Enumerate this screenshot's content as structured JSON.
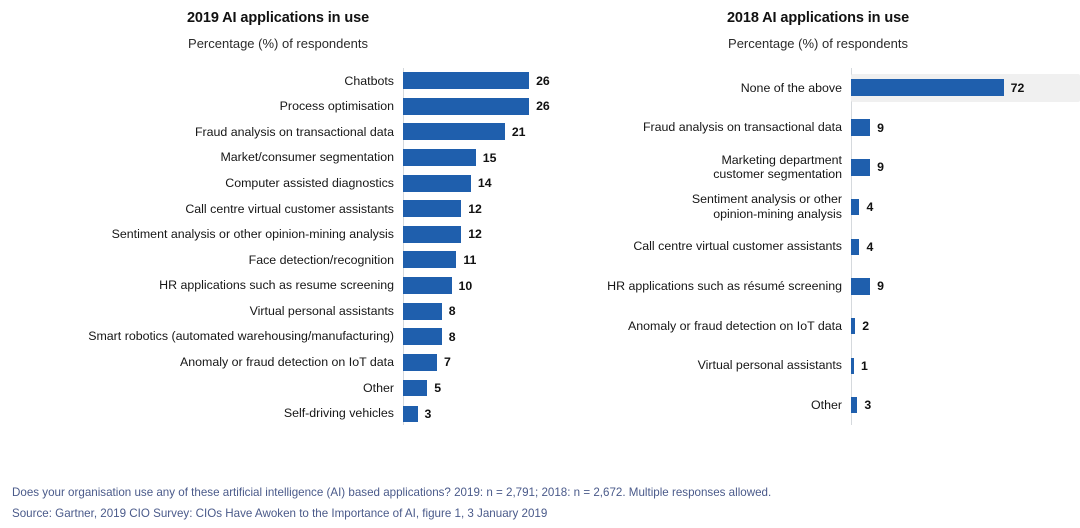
{
  "left_panel": {
    "title": "2019 AI applications in use",
    "subtitle": "Percentage (%) of respondents"
  },
  "right_panel": {
    "title": "2018 AI applications in use",
    "subtitle": "Percentage (%) of respondents"
  },
  "footer": {
    "line1": "Does your organisation use any of these artificial intelligence (AI) based applications? 2019: n = 2,791; 2018: n = 2,672. Multiple responses allowed.",
    "line2": "Source: Gartner, 2019 CIO Survey: CIOs Have Awoken to the Importance of AI, figure 1, 3 January 2019",
    "color": "#4a5a8a"
  },
  "colors": {
    "bar": "#1f5fad",
    "axis": "#d5d9dd",
    "chip": "#f0f0f0",
    "text": "#161616"
  },
  "chart_data": [
    {
      "type": "bar",
      "title": "2019 AI applications in use",
      "subtitle": "Percentage (%) of respondents",
      "orientation": "horizontal",
      "xlabel": "Percentage (%) of respondents",
      "ylabel": "",
      "xlim": [
        0,
        30
      ],
      "grid": false,
      "legend": "none",
      "categories": [
        "Chatbots",
        "Process optimisation",
        "Fraud analysis on transactional data",
        "Market/consumer segmentation",
        "Computer assisted diagnostics",
        "Call centre virtual customer assistants",
        "Sentiment analysis or other opinion-mining analysis",
        "Face detection/recognition",
        "HR applications such as resume screening",
        "Virtual personal assistants",
        "Smart robotics (automated warehousing/manufacturing)",
        "Anomaly or fraud detection on IoT data",
        "Other",
        "Self-driving vehicles"
      ],
      "values": [
        26,
        26,
        21,
        15,
        14,
        12,
        12,
        11,
        10,
        8,
        8,
        7,
        5,
        3
      ],
      "data_labels": [
        "26",
        "26",
        "21",
        "15",
        "14",
        "12",
        "12",
        "11",
        "10",
        "8",
        "8",
        "7",
        "5",
        "3"
      ]
    },
    {
      "type": "bar",
      "title": "2018 AI applications in use",
      "subtitle": "Percentage (%) of respondents",
      "orientation": "horizontal",
      "xlabel": "Percentage (%) of respondents",
      "ylabel": "",
      "xlim": [
        0,
        80
      ],
      "grid": false,
      "legend": "none",
      "categories": [
        "None of the above",
        "Fraud analysis on transactional data",
        "Marketing department\ncustomer segmentation",
        "Sentiment analysis or other\nopinion-mining analysis",
        "Call centre virtual customer assistants",
        "HR applications such as résumé screening",
        "Anomaly or fraud detection on IoT data",
        "Virtual personal assistants",
        "Other"
      ],
      "values": [
        72,
        9,
        9,
        4,
        4,
        9,
        2,
        1,
        3
      ],
      "data_labels": [
        "72",
        "9",
        "9",
        "4",
        "4",
        "9",
        "2",
        "1",
        "3"
      ]
    }
  ]
}
